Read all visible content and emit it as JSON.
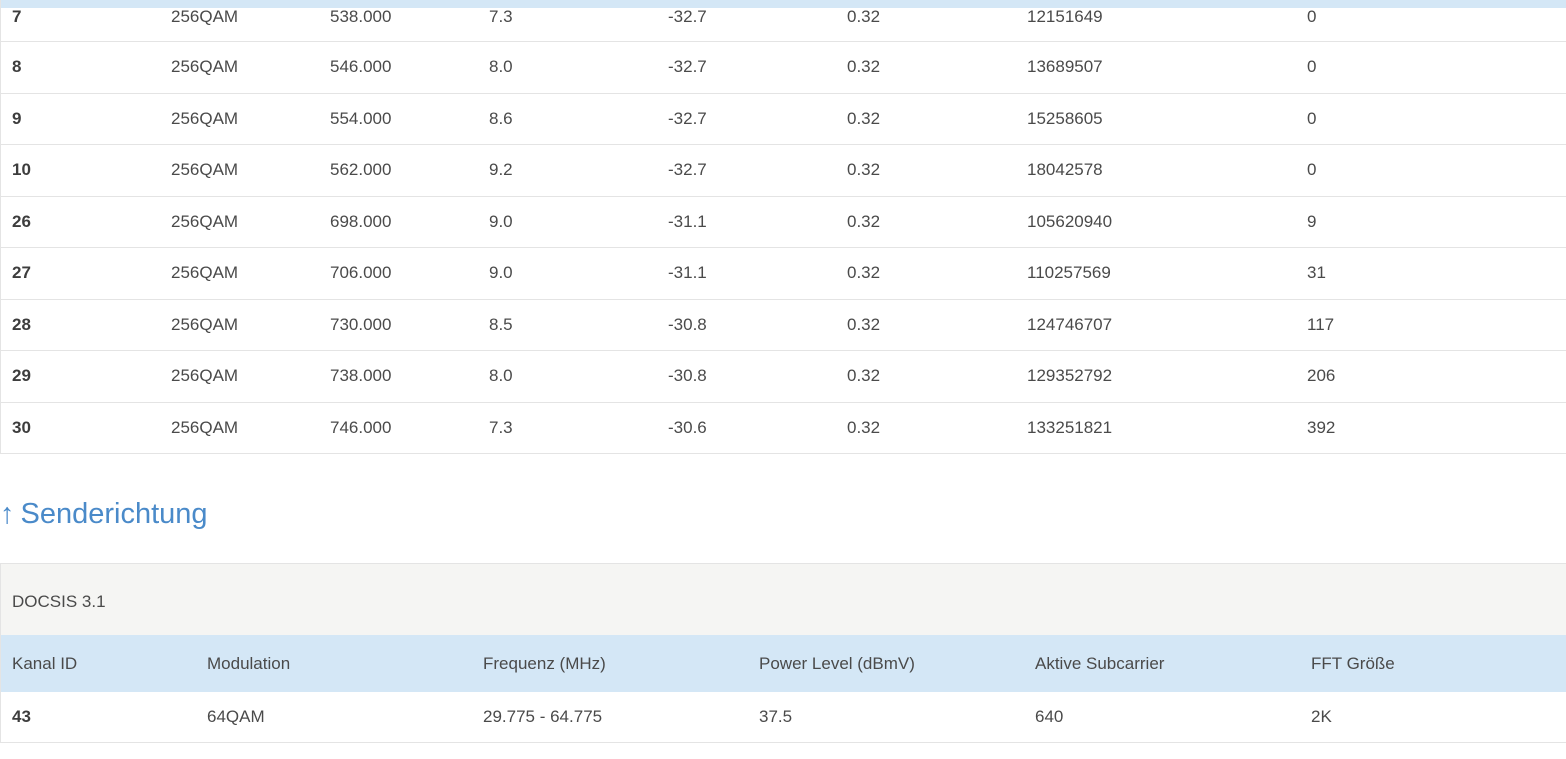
{
  "downstream": {
    "rows": [
      [
        "7",
        "256QAM",
        "538.000",
        "7.3",
        "-32.7",
        "0.32",
        "12151649",
        "0"
      ],
      [
        "8",
        "256QAM",
        "546.000",
        "8.0",
        "-32.7",
        "0.32",
        "13689507",
        "0"
      ],
      [
        "9",
        "256QAM",
        "554.000",
        "8.6",
        "-32.7",
        "0.32",
        "15258605",
        "0"
      ],
      [
        "10",
        "256QAM",
        "562.000",
        "9.2",
        "-32.7",
        "0.32",
        "18042578",
        "0"
      ],
      [
        "26",
        "256QAM",
        "698.000",
        "9.0",
        "-31.1",
        "0.32",
        "105620940",
        "9"
      ],
      [
        "27",
        "256QAM",
        "706.000",
        "9.0",
        "-31.1",
        "0.32",
        "110257569",
        "31"
      ],
      [
        "28",
        "256QAM",
        "730.000",
        "8.5",
        "-30.8",
        "0.32",
        "124746707",
        "117"
      ],
      [
        "29",
        "256QAM",
        "738.000",
        "8.0",
        "-30.8",
        "0.32",
        "129352792",
        "206"
      ],
      [
        "30",
        "256QAM",
        "746.000",
        "7.3",
        "-30.6",
        "0.32",
        "133251821",
        "392"
      ]
    ]
  },
  "upstream": {
    "title_arrow": "↑",
    "title": "Senderichtung",
    "caption": "DOCSIS 3.1",
    "headers": [
      "Kanal ID",
      "Modulation",
      "Frequenz (MHz)",
      "Power Level (dBmV)",
      "Aktive Subcarrier",
      "FFT Größe"
    ],
    "rows": [
      [
        "43",
        "64QAM",
        "29.775 - 64.775",
        "37.5",
        "640",
        "2K"
      ]
    ]
  },
  "colors": {
    "accent": "#4a8ac9",
    "header_bg": "#d4e7f6",
    "caption_bg": "#f5f5f3"
  }
}
